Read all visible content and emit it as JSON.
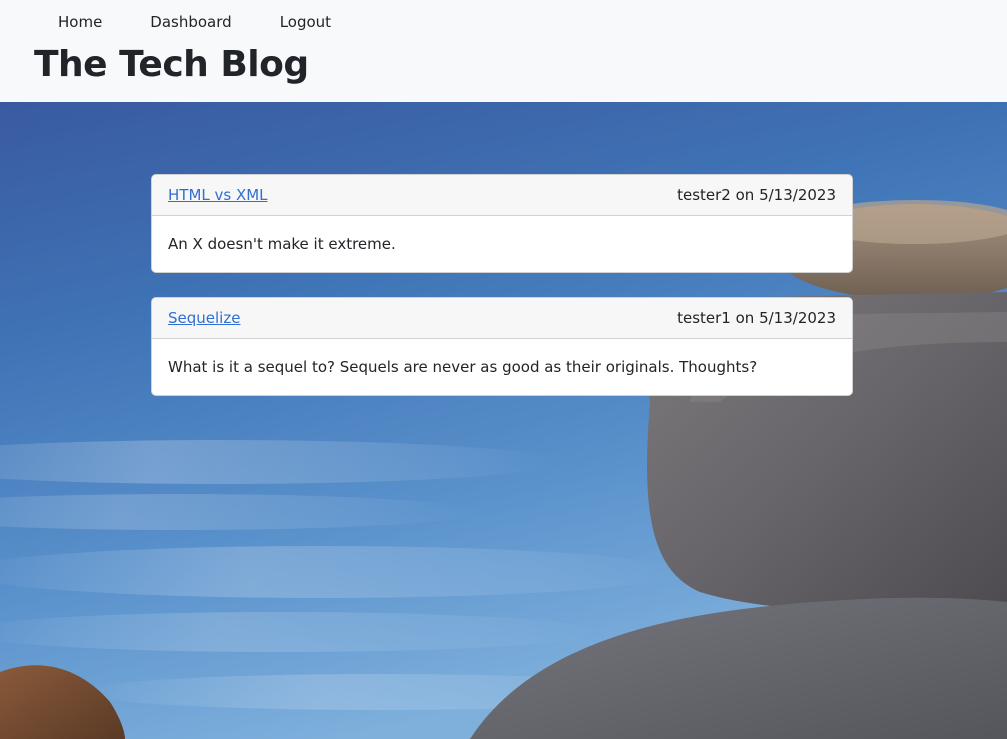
{
  "nav": {
    "home": "Home",
    "dashboard": "Dashboard",
    "logout": "Logout"
  },
  "site": {
    "title": "The Tech Blog"
  },
  "posts": [
    {
      "title": "HTML vs XML",
      "author": "tester2",
      "date": "5/13/2023",
      "meta": "tester2 on 5/13/2023",
      "body": "An X doesn't make it extreme."
    },
    {
      "title": "Sequelize",
      "author": "tester1",
      "date": "5/13/2023",
      "meta": "tester1 on 5/13/2023",
      "body": "What is it a sequel to? Sequels are never as good as their originals. Thoughts?"
    }
  ],
  "colors": {
    "header_bg": "#f8f9fa",
    "link": "#2f6fd6",
    "card_header_bg": "#f7f7f7",
    "sky_top": "#3b5fa6",
    "sky_bottom": "#6aa3d6"
  }
}
